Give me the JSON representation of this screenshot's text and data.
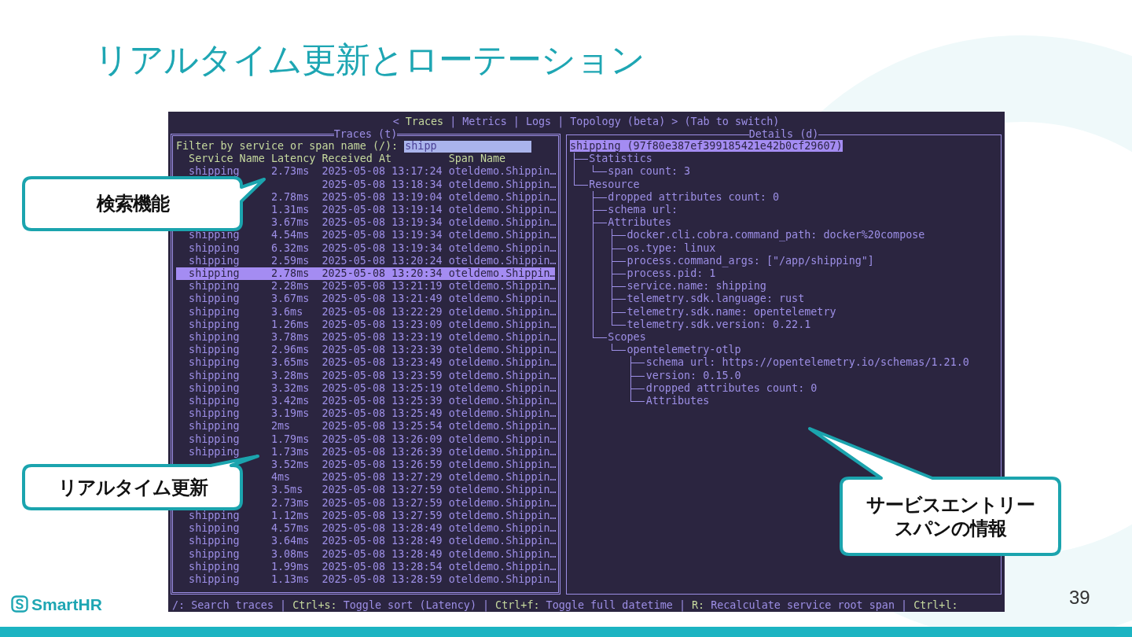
{
  "slide": {
    "title": "リアルタイム更新とローテーション",
    "page_number": "39",
    "logo_text": "SmartHR"
  },
  "terminal": {
    "tab_bar": [
      {
        "kind": "arrow",
        "text": "<"
      },
      {
        "kind": "tab",
        "text": "Traces",
        "selected": true
      },
      {
        "kind": "separator",
        "text": "|"
      },
      {
        "kind": "tab",
        "text": "Metrics",
        "selected": false
      },
      {
        "kind": "separator",
        "text": "|"
      },
      {
        "kind": "tab",
        "text": "Logs",
        "selected": false
      },
      {
        "kind": "separator",
        "text": "|"
      },
      {
        "kind": "tab",
        "text": "Topology (beta)",
        "selected": false
      },
      {
        "kind": "arrow",
        "text": ">"
      },
      {
        "kind": "hint",
        "text": "(Tab to switch)"
      }
    ],
    "traces_panel": {
      "title": "Traces (t)",
      "focused": true,
      "filter_label": "Filter by service or span name (/):",
      "filter_value": "shipp",
      "columns": [
        "Service Name",
        "Latency",
        "Received At",
        "Span Name"
      ],
      "rows": [
        {
          "service": "shipping",
          "latency": "2.73ms",
          "received": "2025-05-08 13:17:24",
          "span": "oteldemo.Shippin…",
          "selected": false
        },
        {
          "received": "2025-05-08 13:18:34",
          "span": "oteldemo.Shippin…",
          "selected": false
        },
        {
          "latency": "2.78ms",
          "received": "2025-05-08 13:19:04",
          "span": "oteldemo.Shippin…",
          "selected": false
        },
        {
          "latency": "1.31ms",
          "received": "2025-05-08 13:19:14",
          "span": "oteldemo.Shippin…",
          "selected": false
        },
        {
          "latency": "3.67ms",
          "received": "2025-05-08 13:19:34",
          "span": "oteldemo.Shippin…",
          "selected": false
        },
        {
          "service": "shipping",
          "latency": "4.54ms",
          "received": "2025-05-08 13:19:34",
          "span": "oteldemo.Shippin…",
          "selected": false
        },
        {
          "service": "shipping",
          "latency": "6.32ms",
          "received": "2025-05-08 13:19:34",
          "span": "oteldemo.Shippin…",
          "selected": false
        },
        {
          "service": "shipping",
          "latency": "2.59ms",
          "received": "2025-05-08 13:20:24",
          "span": "oteldemo.Shippin…",
          "selected": false
        },
        {
          "service": "shipping",
          "latency": "2.78ms",
          "received": "2025-05-08 13:20:34",
          "span": "oteldemo.Shippin…",
          "selected": true
        },
        {
          "service": "shipping",
          "latency": "2.28ms",
          "received": "2025-05-08 13:21:19",
          "span": "oteldemo.Shippin…",
          "selected": false
        },
        {
          "service": "shipping",
          "latency": "3.67ms",
          "received": "2025-05-08 13:21:49",
          "span": "oteldemo.Shippin…",
          "selected": false
        },
        {
          "service": "shipping",
          "latency": "3.6ms",
          "received": "2025-05-08 13:22:29",
          "span": "oteldemo.Shippin…",
          "selected": false
        },
        {
          "service": "shipping",
          "latency": "1.26ms",
          "received": "2025-05-08 13:23:09",
          "span": "oteldemo.Shippin…",
          "selected": false
        },
        {
          "service": "shipping",
          "latency": "3.78ms",
          "received": "2025-05-08 13:23:19",
          "span": "oteldemo.Shippin…",
          "selected": false
        },
        {
          "service": "shipping",
          "latency": "2.96ms",
          "received": "2025-05-08 13:23:39",
          "span": "oteldemo.Shippin…",
          "selected": false
        },
        {
          "service": "shipping",
          "latency": "3.65ms",
          "received": "2025-05-08 13:23:49",
          "span": "oteldemo.Shippin…",
          "selected": false
        },
        {
          "service": "shipping",
          "latency": "3.28ms",
          "received": "2025-05-08 13:23:59",
          "span": "oteldemo.Shippin…",
          "selected": false
        },
        {
          "service": "shipping",
          "latency": "3.32ms",
          "received": "2025-05-08 13:25:19",
          "span": "oteldemo.Shippin…",
          "selected": false
        },
        {
          "service": "shipping",
          "latency": "3.42ms",
          "received": "2025-05-08 13:25:39",
          "span": "oteldemo.Shippin…",
          "selected": false
        },
        {
          "service": "shipping",
          "latency": "3.19ms",
          "received": "2025-05-08 13:25:49",
          "span": "oteldemo.Shippin…",
          "selected": false
        },
        {
          "service": "shipping",
          "latency": "2ms",
          "received": "2025-05-08 13:25:54",
          "span": "oteldemo.Shippin…",
          "selected": false
        },
        {
          "service": "shipping",
          "latency": "1.79ms",
          "received": "2025-05-08 13:26:09",
          "span": "oteldemo.Shippin…",
          "selected": false
        },
        {
          "service": "shipping",
          "latency": "1.73ms",
          "received": "2025-05-08 13:26:39",
          "span": "oteldemo.Shippin…",
          "selected": false
        },
        {
          "latency": "3.52ms",
          "received": "2025-05-08 13:26:59",
          "span": "oteldemo.Shippin…",
          "selected": false
        },
        {
          "latency": "4ms",
          "received": "2025-05-08 13:27:29",
          "span": "oteldemo.Shippin…",
          "selected": false
        },
        {
          "latency": "3.5ms",
          "received": "2025-05-08 13:27:59",
          "span": "oteldemo.Shippin…",
          "selected": false
        },
        {
          "latency": "2.73ms",
          "received": "2025-05-08 13:27:59",
          "span": "oteldemo.Shippin…",
          "selected": false
        },
        {
          "service": "shipping",
          "latency": "1.12ms",
          "received": "2025-05-08 13:27:59",
          "span": "oteldemo.Shippin…",
          "selected": false
        },
        {
          "service": "shipping",
          "latency": "4.57ms",
          "received": "2025-05-08 13:28:49",
          "span": "oteldemo.Shippin…",
          "selected": false
        },
        {
          "service": "shipping",
          "latency": "3.64ms",
          "received": "2025-05-08 13:28:49",
          "span": "oteldemo.Shippin…",
          "selected": false
        },
        {
          "service": "shipping",
          "latency": "3.08ms",
          "received": "2025-05-08 13:28:49",
          "span": "oteldemo.Shippin…",
          "selected": false
        },
        {
          "service": "shipping",
          "latency": "1.99ms",
          "received": "2025-05-08 13:28:54",
          "span": "oteldemo.Shippin…",
          "selected": false
        },
        {
          "service": "shipping",
          "latency": "1.13ms",
          "received": "2025-05-08 13:28:59",
          "span": "oteldemo.Shippin…",
          "selected": false
        }
      ]
    },
    "details_panel": {
      "title": "Details (d)",
      "focused": false,
      "tree": {
        "label": "shipping (97f80e387ef399185421e42b0cf29607)",
        "selected": true,
        "children": [
          {
            "label": "Statistics",
            "selected": false,
            "children": [
              {
                "label": "span count: 3",
                "selected": false
              }
            ]
          },
          {
            "label": "Resource",
            "selected": false,
            "children": [
              {
                "label": "dropped attributes count: 0",
                "selected": false
              },
              {
                "label": "schema url:",
                "selected": false
              },
              {
                "label": "Attributes",
                "selected": false,
                "children": [
                  {
                    "label": "docker.cli.cobra.command_path: docker%20compose",
                    "selected": false
                  },
                  {
                    "label": "os.type: linux",
                    "selected": false
                  },
                  {
                    "label": "process.command_args: [\"/app/shipping\"]",
                    "selected": false
                  },
                  {
                    "label": "process.pid: 1",
                    "selected": false
                  },
                  {
                    "label": "service.name: shipping",
                    "selected": false
                  },
                  {
                    "label": "telemetry.sdk.language: rust",
                    "selected": false
                  },
                  {
                    "label": "telemetry.sdk.name: opentelemetry",
                    "selected": false
                  },
                  {
                    "label": "telemetry.sdk.version: 0.22.1",
                    "selected": false
                  }
                ]
              },
              {
                "label": "Scopes",
                "selected": false,
                "children": [
                  {
                    "label": "opentelemetry-otlp",
                    "selected": false,
                    "children": [
                      {
                        "label": "schema url: https://opentelemetry.io/schemas/1.21.0",
                        "selected": false
                      },
                      {
                        "label": "version: 0.15.0",
                        "selected": false
                      },
                      {
                        "label": "dropped attributes count: 0",
                        "selected": false
                      },
                      {
                        "label": "Attributes",
                        "selected": false
                      }
                    ]
                  }
                ]
              }
            ]
          }
        ]
      }
    },
    "shortcuts": [
      {
        "kind": "action",
        "text": "/: Search traces"
      },
      {
        "kind": "separator",
        "text": "|"
      },
      {
        "kind": "key",
        "text": "Ctrl+s:"
      },
      {
        "kind": "action",
        "text": "Toggle sort (Latency)"
      },
      {
        "kind": "separator",
        "text": "|"
      },
      {
        "kind": "key",
        "text": "Ctrl+f:"
      },
      {
        "kind": "action",
        "text": "Toggle full datetime"
      },
      {
        "kind": "separator",
        "text": "|"
      },
      {
        "kind": "key",
        "text": "R:"
      },
      {
        "kind": "action",
        "text": "Recalculate service root span"
      },
      {
        "kind": "separator",
        "text": "|"
      },
      {
        "kind": "key",
        "text": "Ctrl+l:"
      }
    ]
  },
  "callouts": [
    {
      "kind": "search",
      "lines": [
        "検索機能"
      ]
    },
    {
      "kind": "realtime",
      "lines": [
        "リアルタイム更新"
      ]
    },
    {
      "kind": "details",
      "lines": [
        "サービスエントリー",
        "スパンの情報"
      ]
    }
  ]
}
